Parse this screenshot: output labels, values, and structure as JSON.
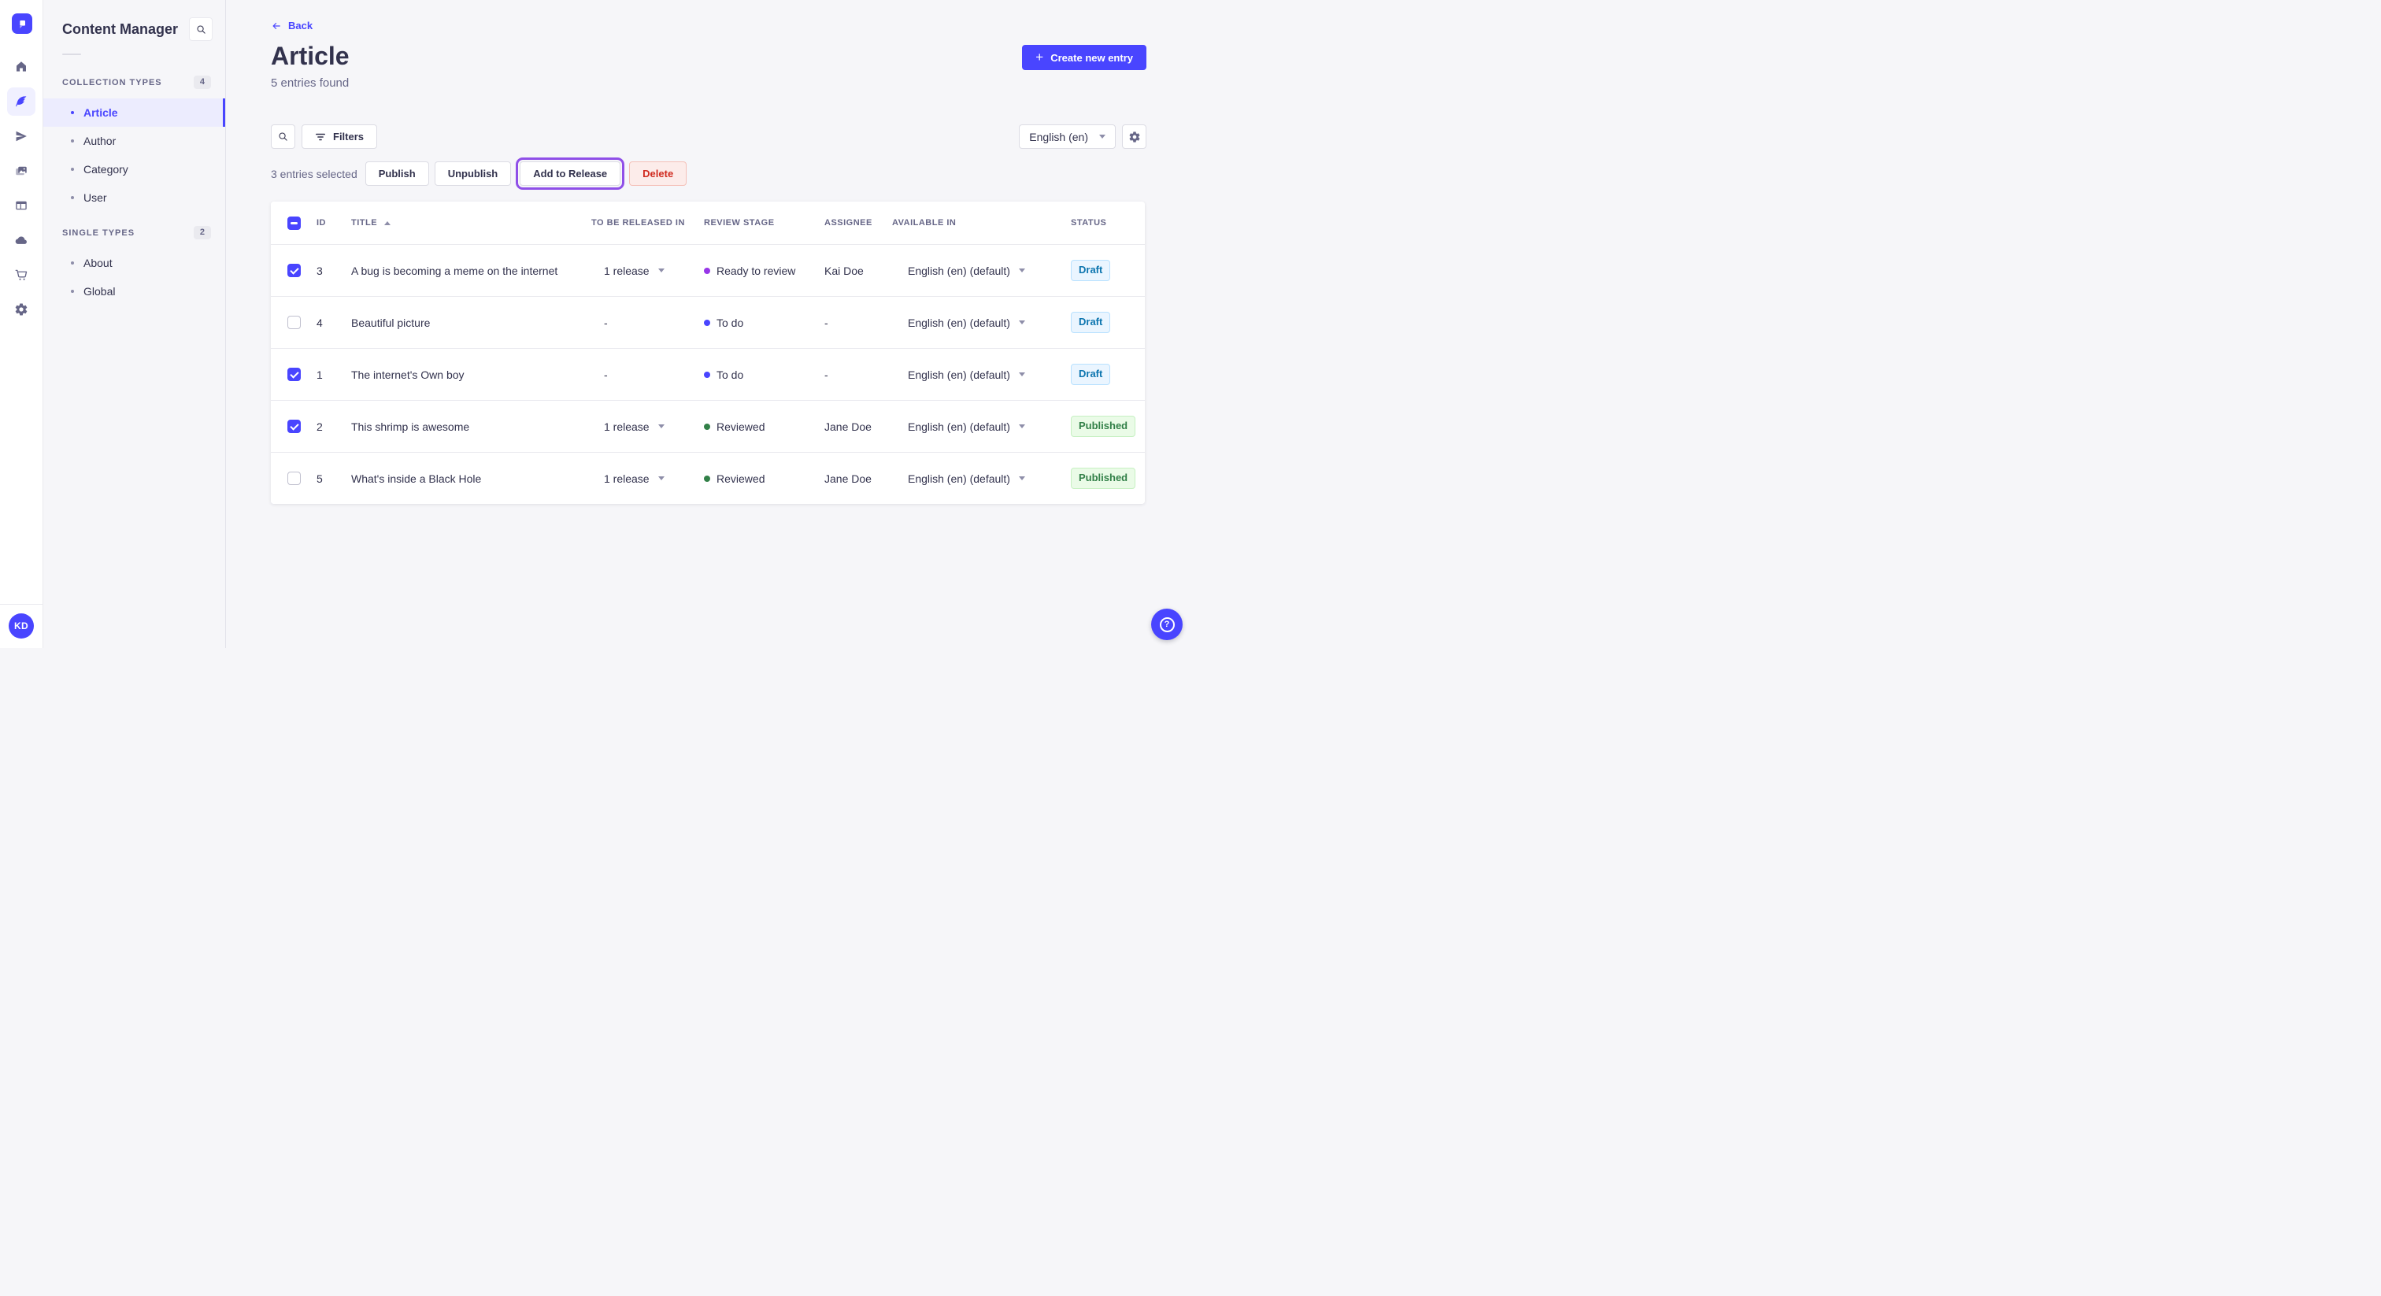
{
  "colors": {
    "accent": "#4945ff",
    "highlight_ring": "#8f4fe8",
    "danger": "#d02b20",
    "draft_text": "#0c75af",
    "published_text": "#328048"
  },
  "rail": {
    "logo_icon": "strapi-logo",
    "items": [
      {
        "icon": "home-icon"
      },
      {
        "icon": "content-manager-icon",
        "active": "true"
      },
      {
        "icon": "releases-icon"
      },
      {
        "icon": "media-library-icon"
      },
      {
        "icon": "content-type-builder-icon"
      },
      {
        "icon": "deploy-icon"
      },
      {
        "icon": "marketplace-icon"
      },
      {
        "icon": "settings-icon"
      }
    ],
    "avatar_initials": "KD"
  },
  "subnav": {
    "title": "Content Manager",
    "search_icon": "search-icon",
    "sections": [
      {
        "label": "COLLECTION TYPES",
        "count": "4",
        "items": [
          {
            "label": "Article",
            "active": "true"
          },
          {
            "label": "Author"
          },
          {
            "label": "Category"
          },
          {
            "label": "User"
          }
        ]
      },
      {
        "label": "SINGLE TYPES",
        "count": "2",
        "items": [
          {
            "label": "About"
          },
          {
            "label": "Global"
          }
        ]
      }
    ]
  },
  "header": {
    "back_label": "Back",
    "title": "Article",
    "subtitle": "5 entries found",
    "create_label": "Create new entry"
  },
  "toolbar": {
    "filters_label": "Filters",
    "locale_value": "English (en)",
    "settings_icon": "gear-icon"
  },
  "selection": {
    "summary": "3 entries selected",
    "publish_label": "Publish",
    "unpublish_label": "Unpublish",
    "add_to_release_label": "Add to Release",
    "delete_label": "Delete"
  },
  "table": {
    "headers": {
      "id": "ID",
      "title": "TITLE",
      "release": "TO BE RELEASED IN",
      "stage": "REVIEW STAGE",
      "assignee": "ASSIGNEE",
      "available": "AVAILABLE IN",
      "status": "STATUS"
    },
    "sort": {
      "column": "TITLE",
      "direction": "ascending"
    },
    "rows": [
      {
        "checked": "true",
        "id": "3",
        "title": "A bug is becoming a meme on the internet",
        "release": "1 release",
        "has_release_dropdown": "true",
        "stage": "Ready to review",
        "stage_color": "#9736e8",
        "assignee": "Kai Doe",
        "locale": "English (en) (default)",
        "status": "Draft"
      },
      {
        "checked": "false",
        "id": "4",
        "title": "Beautiful picture",
        "release": "-",
        "has_release_dropdown": "false",
        "stage": "To do",
        "stage_color": "#4945ff",
        "assignee": "-",
        "locale": "English (en) (default)",
        "status": "Draft"
      },
      {
        "checked": "true",
        "id": "1",
        "title": "The internet's Own boy",
        "release": "-",
        "has_release_dropdown": "false",
        "stage": "To do",
        "stage_color": "#4945ff",
        "assignee": "-",
        "locale": "English (en) (default)",
        "status": "Draft"
      },
      {
        "checked": "true",
        "id": "2",
        "title": "This shrimp is awesome",
        "release": "1 release",
        "has_release_dropdown": "true",
        "stage": "Reviewed",
        "stage_color": "#328048",
        "assignee": "Jane Doe",
        "locale": "English (en) (default)",
        "status": "Published"
      },
      {
        "checked": "false",
        "id": "5",
        "title": "What's inside a Black Hole",
        "release": "1 release",
        "has_release_dropdown": "true",
        "stage": "Reviewed",
        "stage_color": "#328048",
        "assignee": "Jane Doe",
        "locale": "English (en) (default)",
        "status": "Published"
      }
    ]
  },
  "floating": {
    "help_icon": "help-icon"
  }
}
